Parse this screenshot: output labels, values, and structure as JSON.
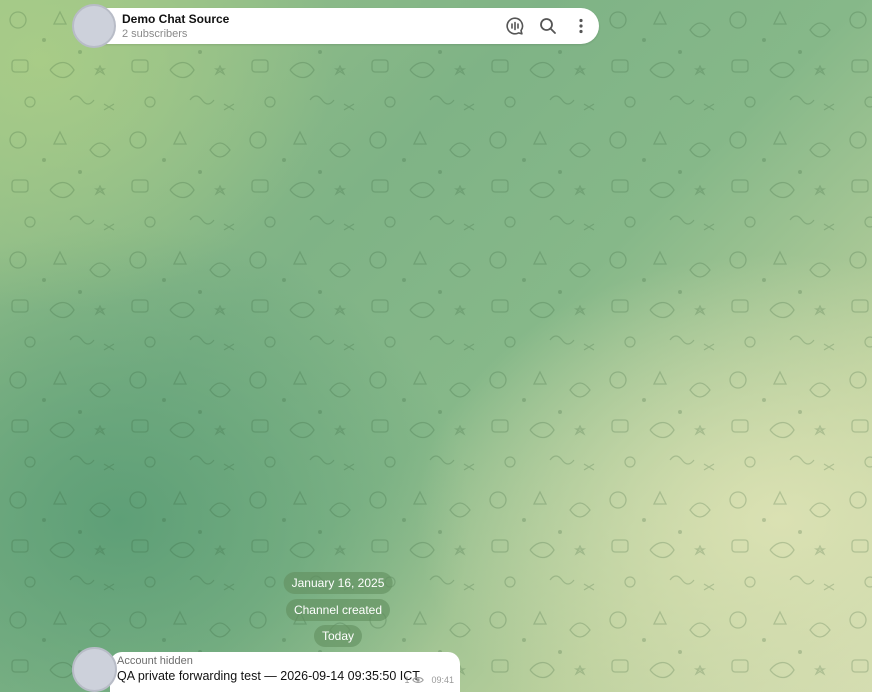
{
  "header": {
    "title": "Demo Chat Source",
    "subtitle": "2 subscribers",
    "icons": [
      "voice-chat-icon",
      "search-icon",
      "more-vert-icon"
    ]
  },
  "service": {
    "date_label": "January 16, 2025",
    "channel_created": "Channel created",
    "today_label": "Today"
  },
  "message": {
    "author": "Account hidden",
    "text": "QA private forwarding test — 2026-09-14 09:35:50 ICT",
    "views": "1",
    "time": "09:41"
  },
  "colors": {
    "header_bg": "#ffffff",
    "pill_bg": "#628f60",
    "avatar_placeholder": "#cdd1db"
  }
}
